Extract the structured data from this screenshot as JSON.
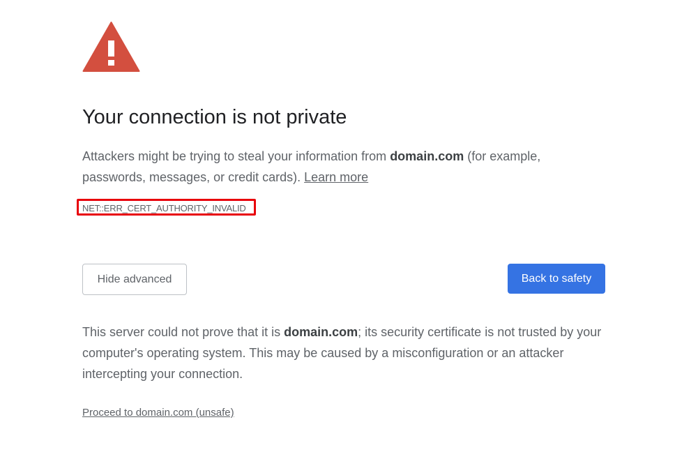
{
  "icon": "warning-triangle-icon",
  "colors": {
    "icon_red": "#d34f3f",
    "primary_blue": "#3573e3",
    "highlight_red": "#e8000b",
    "title": "#202124",
    "text": "#5f6368"
  },
  "heading": "Your connection is not private",
  "explanation": {
    "prefix": "Attackers might be trying to steal your information from ",
    "domain": "domain.com",
    "suffix": " (for example, passwords, messages, or credit cards). ",
    "learn_more": "Learn more"
  },
  "error_code": "NET::ERR_CERT_AUTHORITY_INVALID",
  "buttons": {
    "hide_advanced": "Hide advanced",
    "back_to_safety": "Back to safety"
  },
  "details": {
    "prefix": "This server could not prove that it is ",
    "domain": "domain.com",
    "suffix": "; its security certificate is not trusted by your computer's operating system. This may be caused by a misconfiguration or an attacker intercepting your connection."
  },
  "proceed_link": "Proceed to domain.com (unsafe)"
}
